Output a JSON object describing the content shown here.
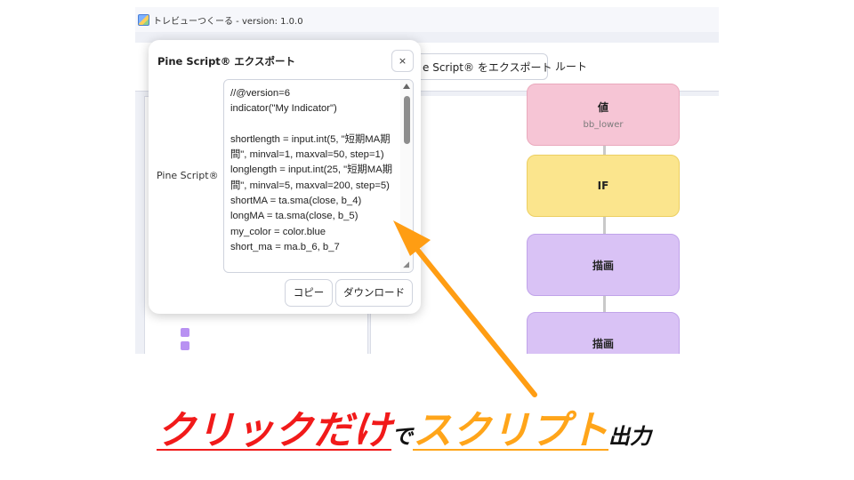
{
  "window": {
    "title": "トレビューつくーる - version: 1.0.0",
    "app_icon": "app-logo-icon"
  },
  "toolbar": {
    "export_button_label": "e Script® をエクスポート",
    "route_label": "ルート"
  },
  "flow": {
    "nodes": [
      {
        "title": "値",
        "subtitle": "bb_lower",
        "color": "#f6c5d5"
      },
      {
        "title": "IF",
        "subtitle": "",
        "color": "#fbe58d"
      },
      {
        "title": "描画",
        "subtitle": "",
        "color": "#d9c2f5"
      },
      {
        "title": "描画",
        "subtitle": "",
        "color": "#d9c2f5"
      }
    ]
  },
  "dialog": {
    "title": "Pine Script® エクスポート",
    "close_label": "×",
    "field_label": "Pine Script®",
    "code": "//@version=6\nindicator(\"My Indicator\")\n\nshortlength = input.int(5, \"短期MA期間\", minval=1, maxval=50, step=1)\nlonglength = input.int(25, \"短期MA期間\", minval=5, maxval=200, step=5)\nshortMA = ta.sma(close, b_4)\nlongMA = ta.sma(close, b_5)\nmy_color = color.blue\nshort_ma = ma.b_6, b_7",
    "copy_label": "コピー",
    "download_label": "ダウンロード"
  },
  "caption": {
    "part1": "クリックだけ",
    "part2": "で",
    "part3": "スクリプト",
    "part4": "出力"
  },
  "colors": {
    "arrow": "#ff9d13",
    "caption_red": "#f11a1a",
    "caption_orange": "#ffa51a"
  }
}
